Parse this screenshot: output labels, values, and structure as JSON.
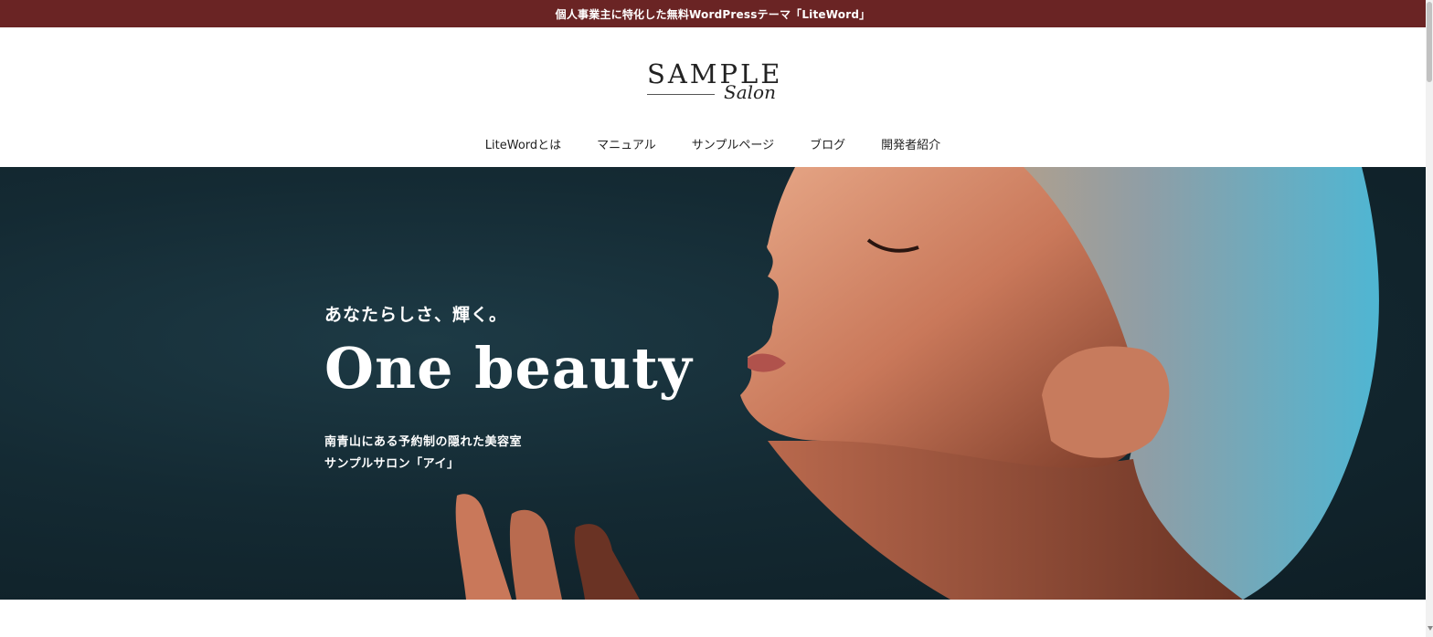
{
  "announcement": {
    "text": "個人事業主に特化した無料WordPressテーマ「LiteWord」"
  },
  "logo": {
    "main": "SAMPLE",
    "sub": "Salon"
  },
  "nav": {
    "items": [
      {
        "label": "LiteWordとは"
      },
      {
        "label": "マニュアル"
      },
      {
        "label": "サンプルページ"
      },
      {
        "label": "ブログ"
      },
      {
        "label": "開発者紹介"
      }
    ]
  },
  "hero": {
    "tagline": "あなたらしさ、輝く。",
    "title": "One beauty",
    "desc_line1": "南青山にある予約制の隠れた美容室",
    "desc_line2": "サンプルサロン「アイ」",
    "image": "woman-profile-closed-eyes-photo"
  },
  "colors": {
    "topbar": "#6a2424",
    "hero_bg": "#142a33",
    "text_light": "#ffffff"
  }
}
